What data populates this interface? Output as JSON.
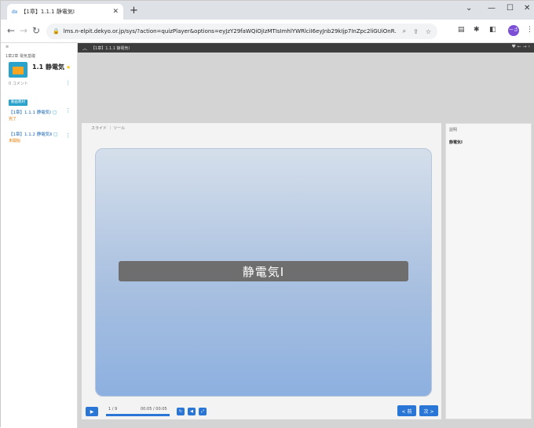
{
  "browser": {
    "tab_title": "【1章】1.1.1 静電気Ⅰ",
    "tab_favicon": "dx",
    "url": "lms.n-elpit.dekyo.or.jp/sys/?action=quizPlayer&options=eyJzY29faWQiOjIzMTIsImhlYWRlciI6eyJnb29kIjp7InZpc2liGUiOnR...",
    "profile_initials": "ーさ"
  },
  "sidebar": {
    "chapter_label": "1章2章 電気基礎",
    "course_title": "1.1 静電気",
    "comment_label": "0 コメント",
    "badge": "動画教材",
    "lessons": [
      {
        "label": "【1章】1.1.1 静電気Ⅰ",
        "status": "完了"
      },
      {
        "label": "【1章】1.1.2 静電気Ⅱ",
        "status": "未開始"
      }
    ]
  },
  "player": {
    "topbar_title": "【1章】1.1.1 静電気Ⅰ",
    "slide_tabs": "スライド ｜ ツール",
    "slide_title": "静電気Ⅰ",
    "notes_header": "説明",
    "notes_text": "静電気Ⅰ",
    "page_count": "1 / 9",
    "timecode": "00:05 / 00:05",
    "progress": 1.0,
    "prev_label": "< 前",
    "next_label": "次 >"
  },
  "colors": {
    "accent": "#2a76d6",
    "topbar": "#3d3d3d",
    "slide_title_bar": "#6e6e6e"
  }
}
